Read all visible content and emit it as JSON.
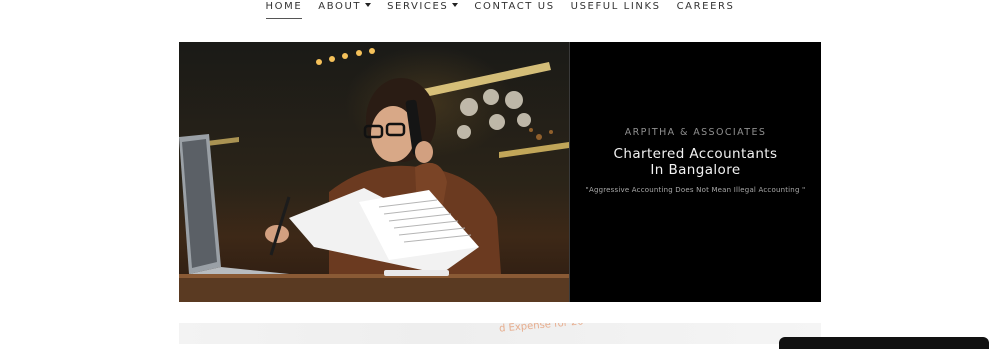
{
  "nav": {
    "items": [
      {
        "label": "HOME",
        "active": true,
        "has_dropdown": false
      },
      {
        "label": "ABOUT",
        "active": false,
        "has_dropdown": true
      },
      {
        "label": "SERVICES",
        "active": false,
        "has_dropdown": true
      },
      {
        "label": "CONTACT US",
        "active": false,
        "has_dropdown": false
      },
      {
        "label": "USEFUL LINKS",
        "active": false,
        "has_dropdown": false
      },
      {
        "label": "CAREERS",
        "active": false,
        "has_dropdown": false
      }
    ]
  },
  "hero": {
    "firm_name": "ARPITHA & ASSOCIATES",
    "headline_line1": "Chartered Accountants",
    "headline_line2": "In Bangalore",
    "tagline": "\"Aggressive Accounting Does Not Mean Illegal Accounting \""
  },
  "strip": {
    "partial_text": "d Expense for 20"
  },
  "colors": {
    "hero_background": "#000000",
    "nav_text": "#333333",
    "firm_name": "#8f8f8f",
    "headline": "#f2f2f2"
  }
}
